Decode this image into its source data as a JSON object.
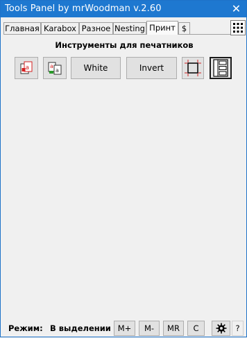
{
  "window": {
    "title": "Tools Panel by mrWoodman v.2.60",
    "close_glyph": "✕"
  },
  "tabs": [
    {
      "label": "Главная",
      "active": false
    },
    {
      "label": "Karabox",
      "active": false
    },
    {
      "label": "Разное",
      "active": false
    },
    {
      "label": "Nesting",
      "active": false
    },
    {
      "label": "Принт",
      "active": true
    },
    {
      "label": "$",
      "active": false
    }
  ],
  "panel": {
    "title": "Инструменты для печатников",
    "buttons": {
      "white": "White",
      "invert": "Invert"
    }
  },
  "icons": {
    "grid": "grid-icon",
    "print_red": "print-red-icon",
    "print_green": "print-green-icon",
    "crop_marks": "crop-marks-icon",
    "layout": "layout-icon",
    "settings": "gear-icon"
  },
  "status": {
    "mode_label": "Режим:",
    "mode_value": "В выделении",
    "m_plus": "M+",
    "m_minus": "M-",
    "mr": "MR",
    "c": "C",
    "help": "?"
  },
  "colors": {
    "titlebar": "#1e78d0",
    "accent_red": "#d42020",
    "accent_green": "#2a9a2a"
  }
}
